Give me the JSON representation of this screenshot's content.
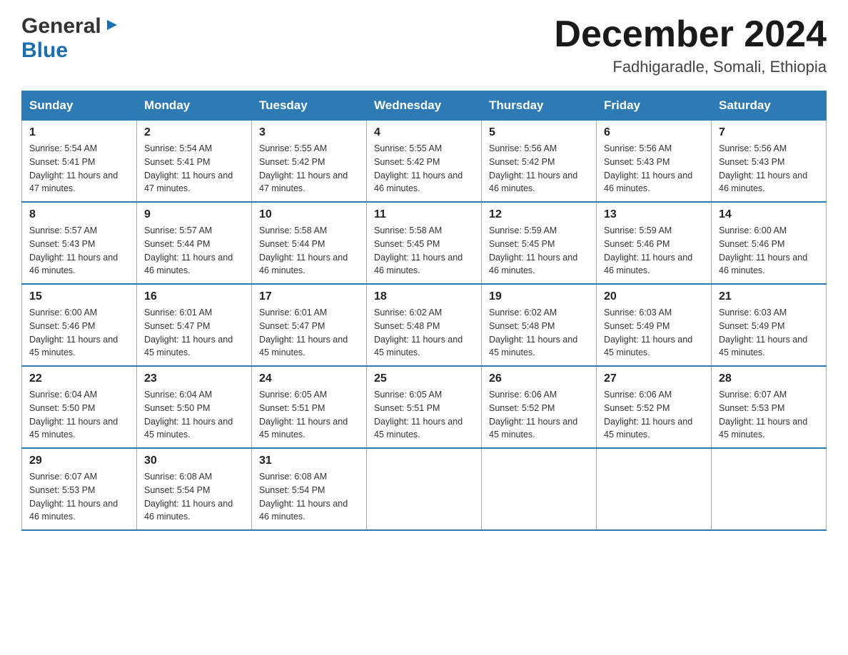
{
  "header": {
    "logo_general": "General",
    "logo_blue": "Blue",
    "month_title": "December 2024",
    "location": "Fadhigaradle, Somali, Ethiopia"
  },
  "calendar": {
    "days_of_week": [
      "Sunday",
      "Monday",
      "Tuesday",
      "Wednesday",
      "Thursday",
      "Friday",
      "Saturday"
    ],
    "weeks": [
      [
        {
          "day": "1",
          "sunrise": "5:54 AM",
          "sunset": "5:41 PM",
          "daylight": "11 hours and 47 minutes."
        },
        {
          "day": "2",
          "sunrise": "5:54 AM",
          "sunset": "5:41 PM",
          "daylight": "11 hours and 47 minutes."
        },
        {
          "day": "3",
          "sunrise": "5:55 AM",
          "sunset": "5:42 PM",
          "daylight": "11 hours and 47 minutes."
        },
        {
          "day": "4",
          "sunrise": "5:55 AM",
          "sunset": "5:42 PM",
          "daylight": "11 hours and 46 minutes."
        },
        {
          "day": "5",
          "sunrise": "5:56 AM",
          "sunset": "5:42 PM",
          "daylight": "11 hours and 46 minutes."
        },
        {
          "day": "6",
          "sunrise": "5:56 AM",
          "sunset": "5:43 PM",
          "daylight": "11 hours and 46 minutes."
        },
        {
          "day": "7",
          "sunrise": "5:56 AM",
          "sunset": "5:43 PM",
          "daylight": "11 hours and 46 minutes."
        }
      ],
      [
        {
          "day": "8",
          "sunrise": "5:57 AM",
          "sunset": "5:43 PM",
          "daylight": "11 hours and 46 minutes."
        },
        {
          "day": "9",
          "sunrise": "5:57 AM",
          "sunset": "5:44 PM",
          "daylight": "11 hours and 46 minutes."
        },
        {
          "day": "10",
          "sunrise": "5:58 AM",
          "sunset": "5:44 PM",
          "daylight": "11 hours and 46 minutes."
        },
        {
          "day": "11",
          "sunrise": "5:58 AM",
          "sunset": "5:45 PM",
          "daylight": "11 hours and 46 minutes."
        },
        {
          "day": "12",
          "sunrise": "5:59 AM",
          "sunset": "5:45 PM",
          "daylight": "11 hours and 46 minutes."
        },
        {
          "day": "13",
          "sunrise": "5:59 AM",
          "sunset": "5:46 PM",
          "daylight": "11 hours and 46 minutes."
        },
        {
          "day": "14",
          "sunrise": "6:00 AM",
          "sunset": "5:46 PM",
          "daylight": "11 hours and 46 minutes."
        }
      ],
      [
        {
          "day": "15",
          "sunrise": "6:00 AM",
          "sunset": "5:46 PM",
          "daylight": "11 hours and 45 minutes."
        },
        {
          "day": "16",
          "sunrise": "6:01 AM",
          "sunset": "5:47 PM",
          "daylight": "11 hours and 45 minutes."
        },
        {
          "day": "17",
          "sunrise": "6:01 AM",
          "sunset": "5:47 PM",
          "daylight": "11 hours and 45 minutes."
        },
        {
          "day": "18",
          "sunrise": "6:02 AM",
          "sunset": "5:48 PM",
          "daylight": "11 hours and 45 minutes."
        },
        {
          "day": "19",
          "sunrise": "6:02 AM",
          "sunset": "5:48 PM",
          "daylight": "11 hours and 45 minutes."
        },
        {
          "day": "20",
          "sunrise": "6:03 AM",
          "sunset": "5:49 PM",
          "daylight": "11 hours and 45 minutes."
        },
        {
          "day": "21",
          "sunrise": "6:03 AM",
          "sunset": "5:49 PM",
          "daylight": "11 hours and 45 minutes."
        }
      ],
      [
        {
          "day": "22",
          "sunrise": "6:04 AM",
          "sunset": "5:50 PM",
          "daylight": "11 hours and 45 minutes."
        },
        {
          "day": "23",
          "sunrise": "6:04 AM",
          "sunset": "5:50 PM",
          "daylight": "11 hours and 45 minutes."
        },
        {
          "day": "24",
          "sunrise": "6:05 AM",
          "sunset": "5:51 PM",
          "daylight": "11 hours and 45 minutes."
        },
        {
          "day": "25",
          "sunrise": "6:05 AM",
          "sunset": "5:51 PM",
          "daylight": "11 hours and 45 minutes."
        },
        {
          "day": "26",
          "sunrise": "6:06 AM",
          "sunset": "5:52 PM",
          "daylight": "11 hours and 45 minutes."
        },
        {
          "day": "27",
          "sunrise": "6:06 AM",
          "sunset": "5:52 PM",
          "daylight": "11 hours and 45 minutes."
        },
        {
          "day": "28",
          "sunrise": "6:07 AM",
          "sunset": "5:53 PM",
          "daylight": "11 hours and 45 minutes."
        }
      ],
      [
        {
          "day": "29",
          "sunrise": "6:07 AM",
          "sunset": "5:53 PM",
          "daylight": "11 hours and 46 minutes."
        },
        {
          "day": "30",
          "sunrise": "6:08 AM",
          "sunset": "5:54 PM",
          "daylight": "11 hours and 46 minutes."
        },
        {
          "day": "31",
          "sunrise": "6:08 AM",
          "sunset": "5:54 PM",
          "daylight": "11 hours and 46 minutes."
        },
        null,
        null,
        null,
        null
      ]
    ]
  }
}
